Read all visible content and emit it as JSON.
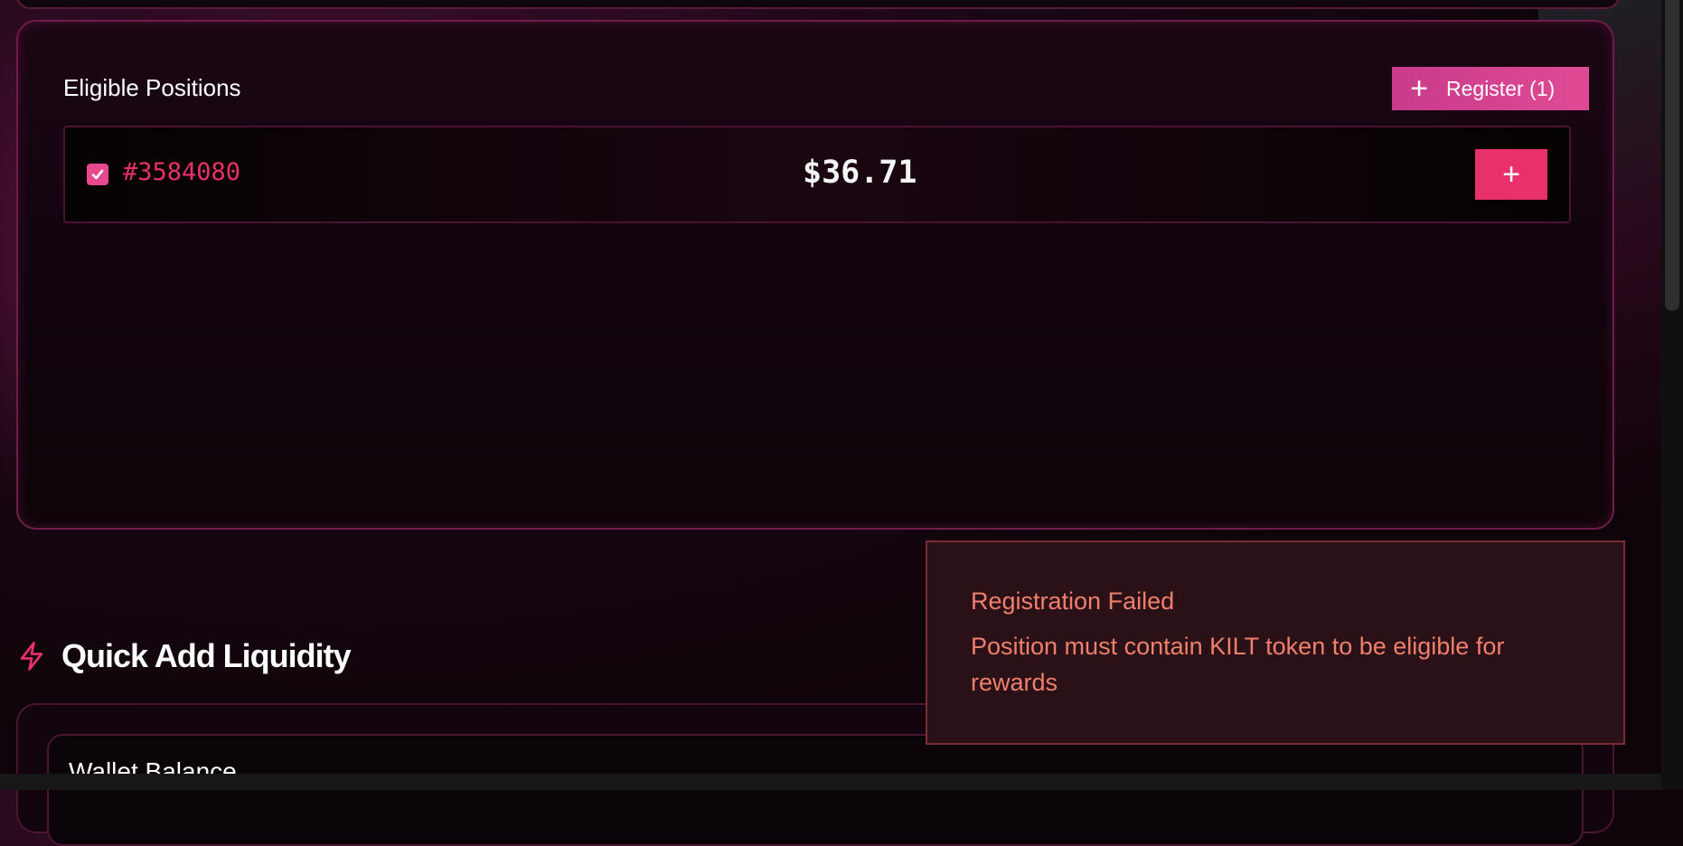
{
  "positions_card": {
    "title": "Eligible Positions",
    "register_label": "Register (1)",
    "register_icon": "plus-icon",
    "positions": [
      {
        "id": "#3584080",
        "value": "$36.71",
        "selected": true,
        "add_icon": "plus-icon"
      }
    ]
  },
  "quick_add": {
    "icon": "lightning-bolt-icon",
    "title": "Quick Add Liquidity",
    "wallet_label": "Wallet Balance"
  },
  "toast": {
    "title": "Registration Failed",
    "message": "Position must contain KILT token to be eligible for rewards"
  },
  "colors": {
    "accent": "#e8306a",
    "accent_pink": "#e04a95",
    "error_text": "#f07f6c",
    "card_border": "#6e1d4b"
  }
}
